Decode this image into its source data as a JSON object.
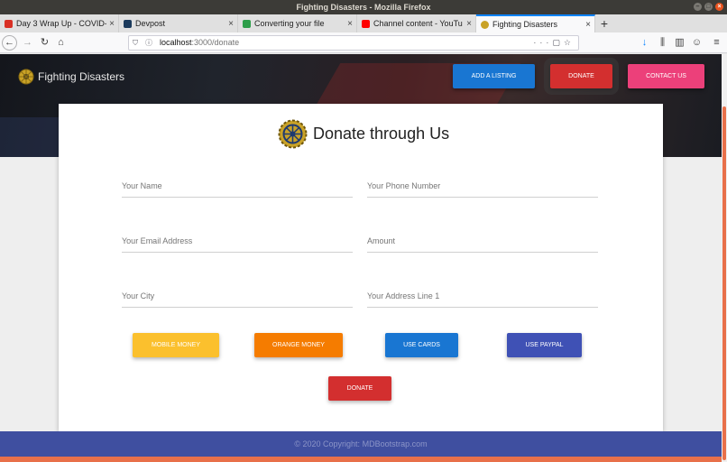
{
  "window": {
    "title": "Fighting Disasters - Mozilla Firefox"
  },
  "tabs": [
    {
      "title": "Day 3 Wrap Up - COVID-",
      "favicon_color": "#d93025"
    },
    {
      "title": "Devpost",
      "favicon_color": "#1b3a5c"
    },
    {
      "title": "Converting your file",
      "favicon_color": "#2e9e4a"
    },
    {
      "title": "Channel content - YouTu",
      "favicon_color": "#ff0000"
    },
    {
      "title": "Fighting Disasters",
      "favicon_color": "#c9a227"
    }
  ],
  "url": {
    "host": "localhost",
    "path": ":3000/donate"
  },
  "site": {
    "brand": "Fighting Disasters",
    "nav": {
      "add_listing": "ADD A LISTING",
      "donate": "DONATE",
      "contact": "CONTACT US"
    }
  },
  "form": {
    "title": "Donate through Us",
    "fields": {
      "name": "Your Name",
      "phone": "Your Phone Number",
      "email": "Your Email Address",
      "amount": "Amount",
      "city": "Your City",
      "address": "Your Address Line 1"
    },
    "payment": {
      "mobile_money": "MOBILE MONEY",
      "orange_money": "ORANGE MONEY",
      "cards": "USE CARDS",
      "paypal": "USE PAYPAL"
    },
    "submit": "DONATE"
  },
  "footer": {
    "copyright": "© 2020 Copyright:",
    "link": "MDBootstrap.com"
  },
  "colors": {
    "blue": "#1976d2",
    "red": "#d32f2f",
    "pink": "#ec407a",
    "amber": "#fbc02d",
    "orange": "#f57c00",
    "indigo": "#3f51b5",
    "footer": "#3f4fa0"
  }
}
